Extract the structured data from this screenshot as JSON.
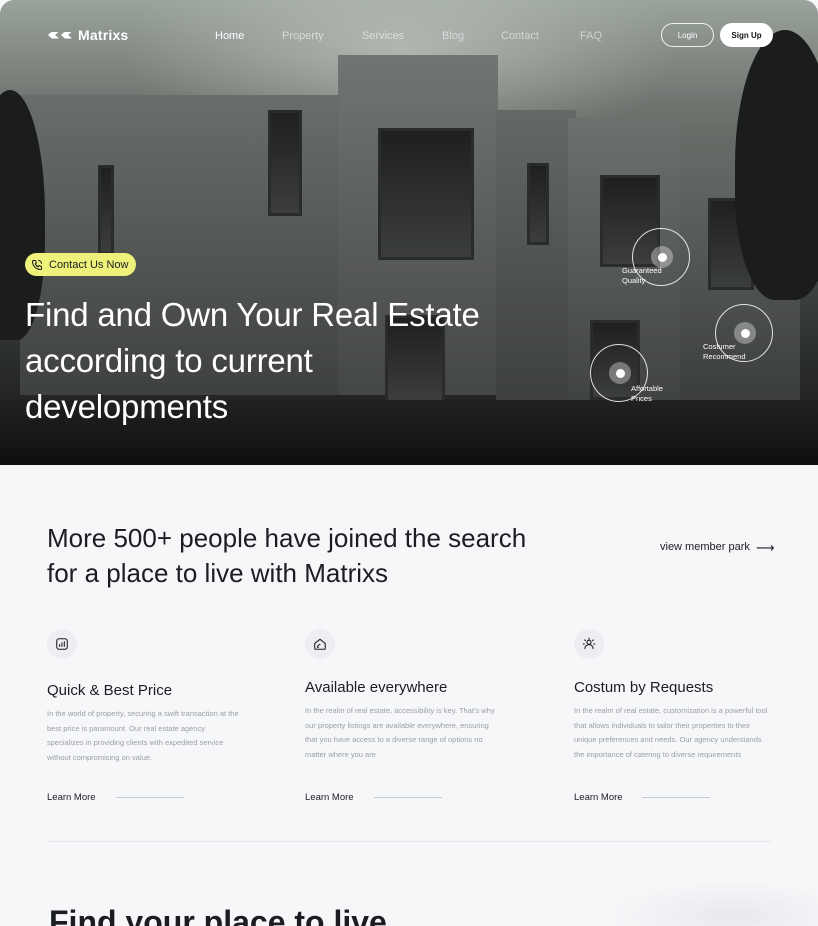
{
  "brand": {
    "name": "Matrixs"
  },
  "nav": {
    "items": [
      {
        "label": "Home",
        "active": true
      },
      {
        "label": "Property",
        "active": false
      },
      {
        "label": "Services",
        "active": false
      },
      {
        "label": "Blog",
        "active": false
      },
      {
        "label": "Contact",
        "active": false
      },
      {
        "label": "FAQ",
        "active": false
      }
    ],
    "login_label": "Login",
    "signup_label": "Sign Up"
  },
  "hero": {
    "contact_label": "Contact Us Now",
    "title": "Find and Own Your Real Estate according to current developments",
    "badges": [
      {
        "line1": "Guaranteed",
        "line2": "Quality"
      },
      {
        "line1": "Costumer",
        "line2": "Recommend"
      },
      {
        "line1": "Affortable",
        "line2": "Prices"
      }
    ]
  },
  "section": {
    "headline": "More 500+ people have joined the search for a place to live with Matrixs",
    "view_link": "view member park",
    "features": [
      {
        "icon": "chart-icon",
        "title": "Quick & Best Price",
        "description": "In the world of property, securing a swift transaction at the best price is paramount. Our real estate agency specializes in providing clients with expedited service without compromising on value.",
        "learn_more": "Learn More"
      },
      {
        "icon": "home-wifi-icon",
        "title": "Available everywhere",
        "description": "In the realm of real estate, accessibility is key. That's why our property listings are available everywhere, ensuring that you have access to a diverse range of options no matter where you are",
        "learn_more": "Learn More"
      },
      {
        "icon": "user-settings-icon",
        "title": "Costum by Requests",
        "description": "In the realm of real estate, customization is a powerful tool that allows individuals to tailor their properties to their unique preferences and needs. Our agency understands the importance of catering to diverse requirements",
        "learn_more": "Learn More"
      }
    ]
  },
  "bottom": {
    "title": "Find your place to live"
  },
  "colors": {
    "accent_yellow": "#eef27a",
    "text_dark": "#1b1d21",
    "muted": "#9a9ea5",
    "page_bg": "#f6f7f9"
  }
}
